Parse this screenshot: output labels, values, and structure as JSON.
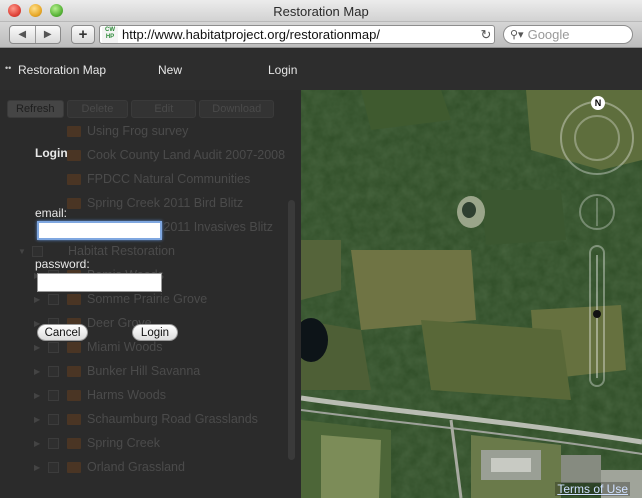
{
  "window": {
    "title": "Restoration Map"
  },
  "browser": {
    "url": "http://www.habitatproject.org/restorationmap/",
    "favicon_text": "CW HP",
    "search_placeholder": "Google",
    "back_glyph": "◀",
    "forward_glyph": "▶",
    "add_glyph": "+",
    "reload_glyph": "↻"
  },
  "appmenu": {
    "brand": "Restoration Map",
    "new_label": "New",
    "login_label": "Login"
  },
  "panel": {
    "tabs": [
      "Refresh",
      "Delete",
      "Edit",
      "Download"
    ],
    "tree": [
      {
        "label": "Using Frog survey",
        "type": "layer"
      },
      {
        "label": "Cook County Land Audit 2007-2008",
        "type": "layer"
      },
      {
        "label": "FPDCC Natural Communities",
        "type": "layer"
      },
      {
        "label": "Spring Creek 2011 Bird Blitz",
        "type": "layer"
      },
      {
        "label": "Spring Creek 2011 Invasives Blitz",
        "type": "layer"
      },
      {
        "label": "Habitat Restoration",
        "type": "group"
      },
      {
        "label": "Bemis Woods",
        "type": "site"
      },
      {
        "label": "Somme Prairie Grove",
        "type": "site"
      },
      {
        "label": "Deer Grove",
        "type": "site"
      },
      {
        "label": "Miami Woods",
        "type": "site"
      },
      {
        "label": "Bunker Hill Savanna",
        "type": "site"
      },
      {
        "label": "Harms Woods",
        "type": "site"
      },
      {
        "label": "Schaumburg Road Grasslands",
        "type": "site"
      },
      {
        "label": "Spring Creek",
        "type": "site"
      },
      {
        "label": "Orland Grassland",
        "type": "site"
      }
    ]
  },
  "login": {
    "title": "Login",
    "email_label": "email:",
    "email_value": "",
    "password_label": "password:",
    "password_value": "",
    "cancel_label": "Cancel",
    "submit_label": "Login"
  },
  "map": {
    "compass_label": "N",
    "terms_label": "Terms of Use"
  },
  "colors": {
    "appbar": "#2d2d2d",
    "focus_ring": "#7fa7e0",
    "terms_link": "#cfe0ff"
  }
}
